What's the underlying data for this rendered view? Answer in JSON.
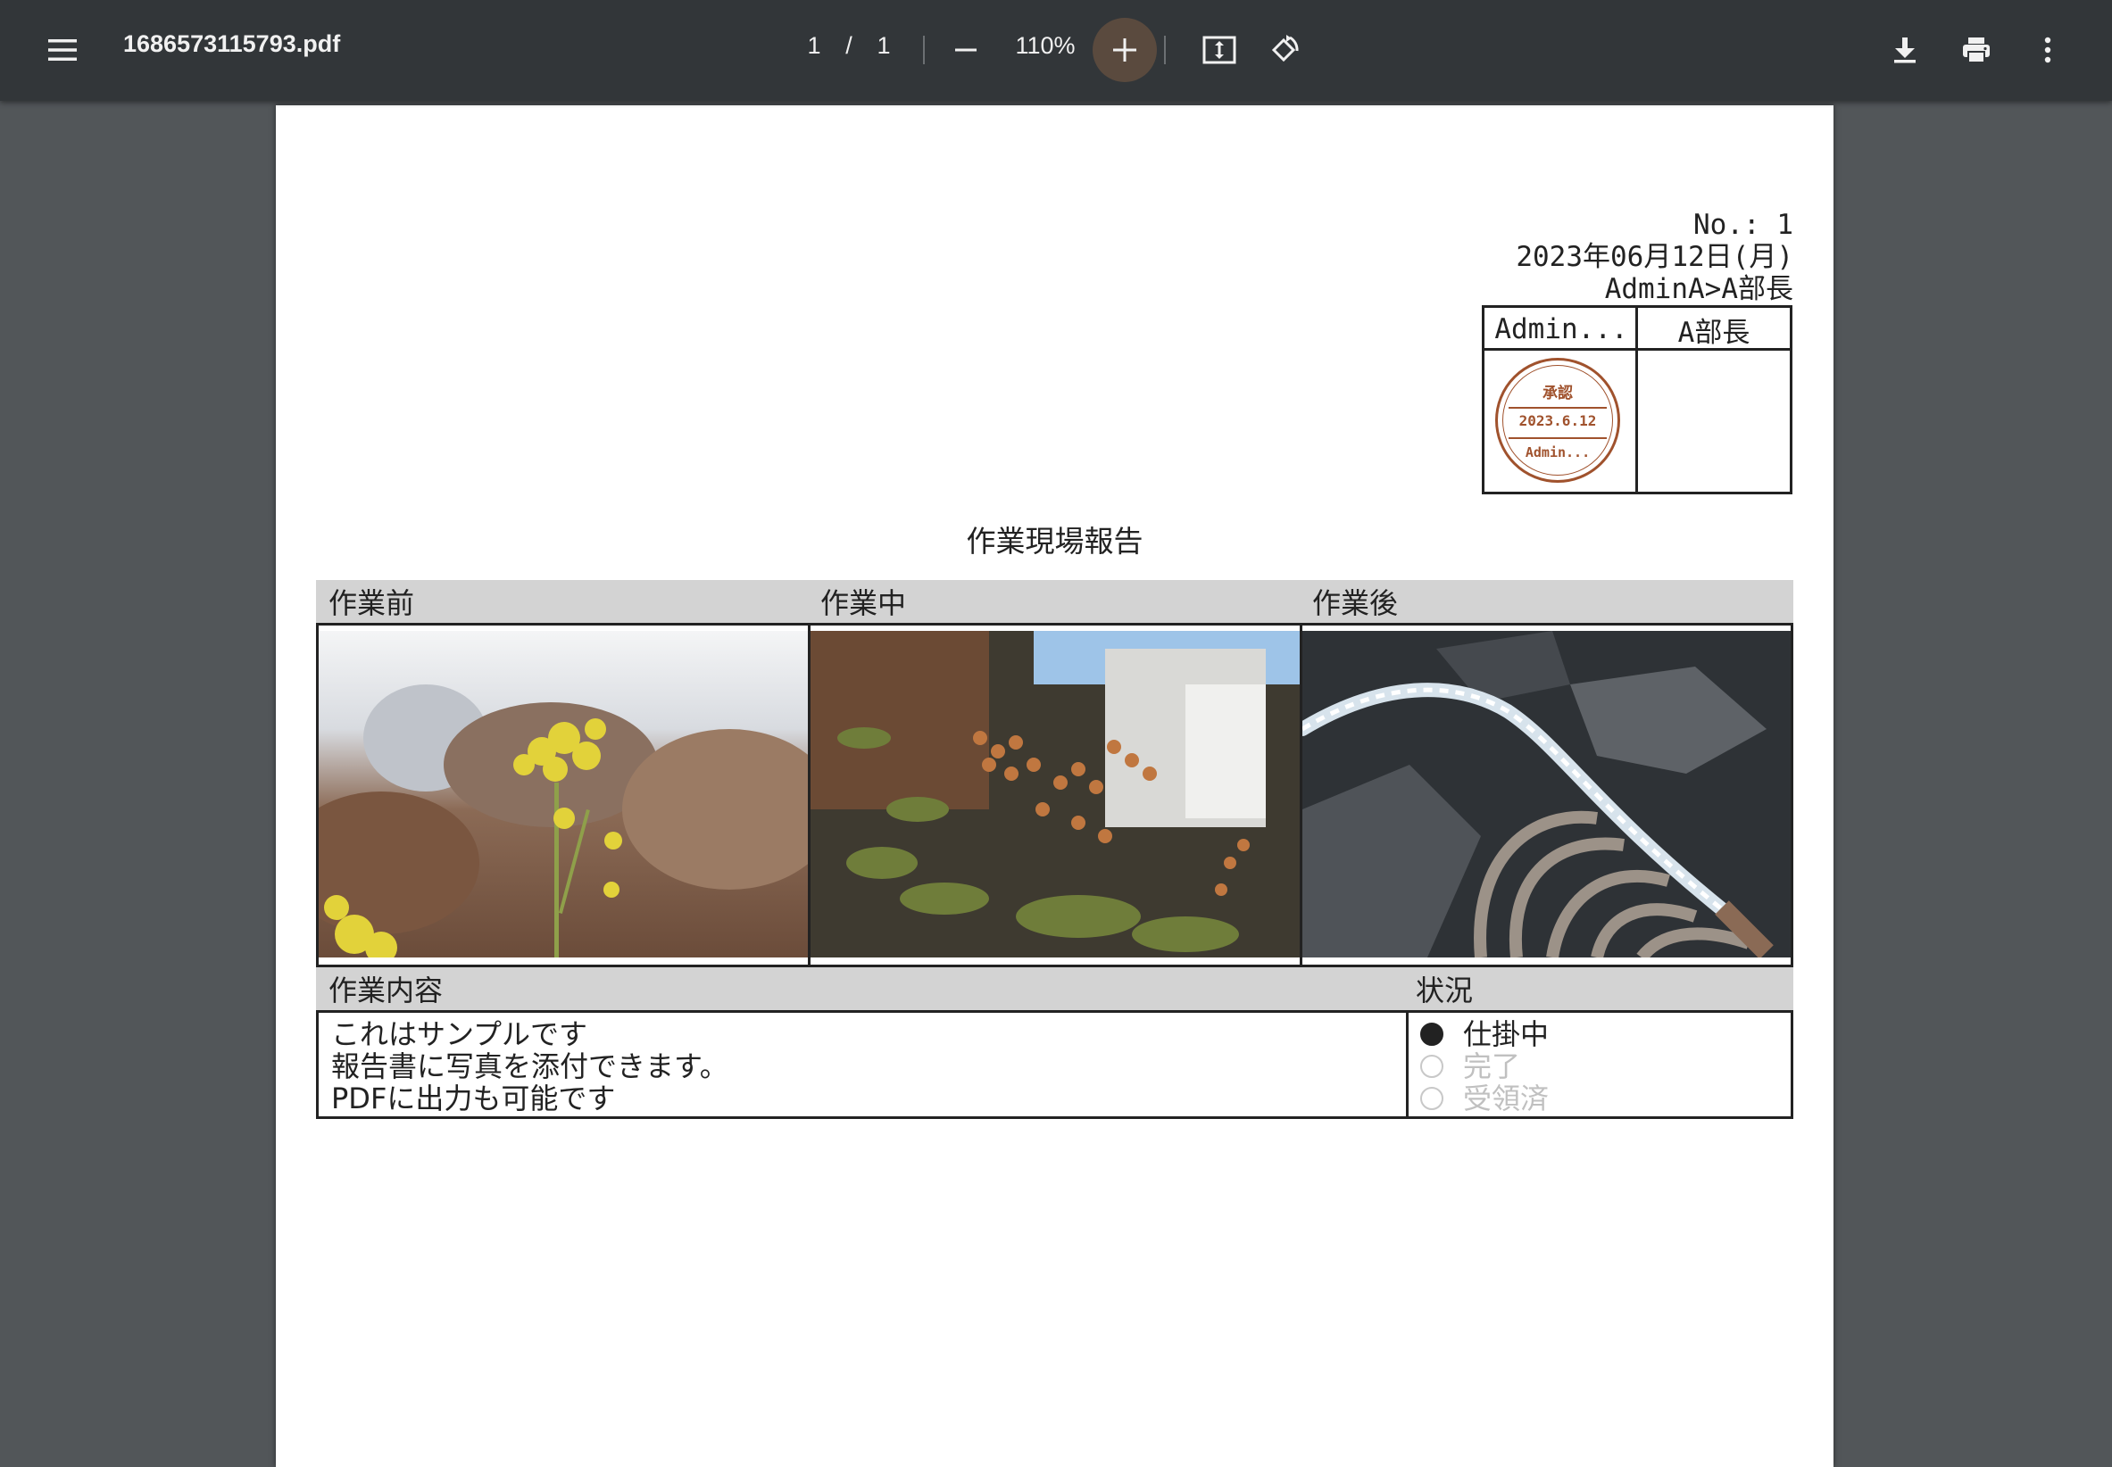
{
  "toolbar": {
    "filename": "1686573115793.pdf",
    "page_current": "1",
    "page_separator": "/",
    "page_total": "1",
    "zoom": "110%",
    "icons": [
      "menu-icon",
      "minus-icon",
      "plus-icon",
      "fit-page-icon",
      "rotate-icon",
      "download-icon",
      "print-icon",
      "more-vert-icon"
    ]
  },
  "document": {
    "number": "No.: 1",
    "date": "2023年06月12日(月)",
    "route": "AdminA>A部長",
    "approval": {
      "col1": "Admin...",
      "col2": "A部長",
      "stamp": {
        "label": "承認",
        "date": "2023.6.12",
        "name": "Admin..."
      }
    },
    "title": "作業現場報告",
    "photo_headers": [
      "作業前",
      "作業中",
      "作業後"
    ],
    "content_header": "作業内容",
    "status_header": "状況",
    "content_lines": [
      "これはサンプルです",
      "報告書に写真を添付できます。",
      "PDFに出力も可能です"
    ],
    "status_options": [
      {
        "label": "仕掛中",
        "selected": true
      },
      {
        "label": "完了",
        "selected": false
      },
      {
        "label": "受領済",
        "selected": false
      }
    ]
  },
  "colors": {
    "toolbar_bg": "#323639",
    "viewer_bg": "#525659",
    "stamp": "#a0522d",
    "header_gray": "#d3d3d3"
  }
}
